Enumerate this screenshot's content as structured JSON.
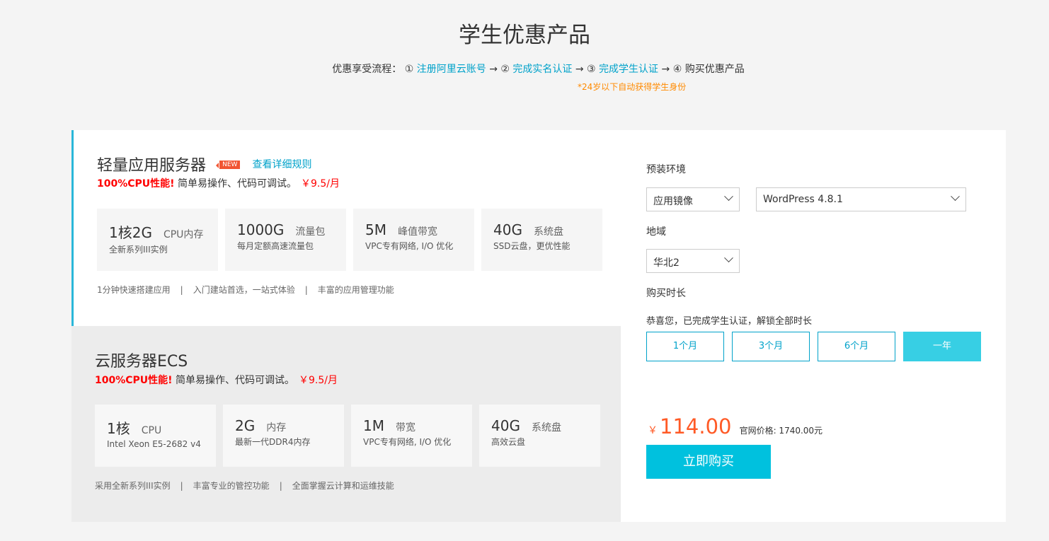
{
  "title": "学生优惠产品",
  "flow": {
    "label": "优惠享受流程：",
    "steps": [
      {
        "num": "①",
        "text": "注册阿里云账号",
        "link": true
      },
      {
        "num": "②",
        "text": "完成实名认证",
        "link": true
      },
      {
        "num": "③",
        "text": "完成学生认证",
        "link": true
      },
      {
        "num": "④",
        "text": "购买优惠产品",
        "link": false
      }
    ],
    "arrow": "→",
    "note": "*24岁以下自动获得学生身份"
  },
  "lite": {
    "title": "轻量应用服务器",
    "badge": "NEW",
    "rules_link": "查看详细规则",
    "highlight": "100%CPU性能!",
    "desc": "简单易操作、代码可调试。",
    "price": "￥9.5/月",
    "specs": [
      {
        "big": "1核2G",
        "unit": "CPU内存",
        "desc": "全新系列III实例"
      },
      {
        "big": "1000G",
        "unit": "流量包",
        "desc": "每月定额高速流量包"
      },
      {
        "big": "5M",
        "unit": "峰值带宽",
        "desc": "VPC专有网络, I/O 优化"
      },
      {
        "big": "40G",
        "unit": "系统盘",
        "desc": "SSD云盘，更优性能"
      }
    ],
    "features": [
      "1分钟快速搭建应用",
      "入门建站首选，一站式体验",
      "丰富的应用管理功能"
    ]
  },
  "ecs": {
    "title": "云服务器ECS",
    "highlight": "100%CPU性能!",
    "desc": "简单易操作、代码可调试。",
    "price": "￥9.5/月",
    "specs": [
      {
        "big": "1核",
        "unit": "CPU",
        "desc": "Intel Xeon E5-2682 v4"
      },
      {
        "big": "2G",
        "unit": "内存",
        "desc": "最新一代DDR4内存"
      },
      {
        "big": "1M",
        "unit": "带宽",
        "desc": "VPC专有网络, I/O 优化"
      },
      {
        "big": "40G",
        "unit": "系统盘",
        "desc": "高效云盘"
      }
    ],
    "features": [
      "采用全新系列III实例",
      "丰富专业的管控功能",
      "全面掌握云计算和运维技能"
    ]
  },
  "sep": "|",
  "config": {
    "env_label": "预装环境",
    "env_type": "应用镜像",
    "env_image": "WordPress 4.8.1",
    "region_label": "地域",
    "region": "华北2",
    "duration_label": "购买时长",
    "duration_note": "恭喜您，已完成学生认证，解锁全部时长",
    "durations": [
      "1个月",
      "3个月",
      "6个月",
      "一年"
    ],
    "selected_duration": "一年",
    "currency": "￥",
    "price": "114.00",
    "list_price": "官网价格: 1740.00元",
    "buy": "立即购买"
  }
}
